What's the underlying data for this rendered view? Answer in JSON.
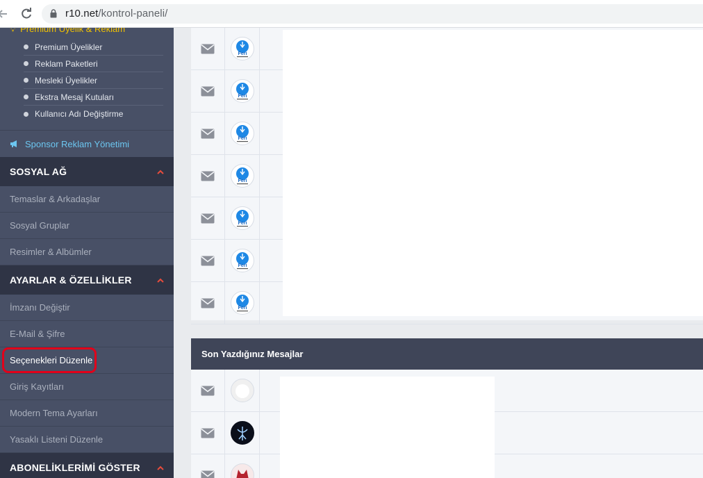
{
  "browser": {
    "url_host": "r10.net",
    "url_path": "/kontrol-paneli/"
  },
  "sidebar": {
    "premium_title": "Premium Üyelik & Reklam",
    "premium_items": [
      {
        "label": "Premium Üyelikler"
      },
      {
        "label": "Reklam Paketleri"
      },
      {
        "label": "Mesleki Üyelikler"
      },
      {
        "label": "Ekstra Mesaj Kutuları"
      },
      {
        "label": "Kullanıcı Adı Değiştirme"
      }
    ],
    "sponsor_label": "Sponsor Reklam Yönetimi",
    "sections": [
      {
        "title": "SOSYAL AĞ",
        "items": [
          {
            "label": "Temaslar & Arkadaşlar"
          },
          {
            "label": "Sosyal Gruplar"
          },
          {
            "label": "Resimler & Albümler"
          }
        ]
      },
      {
        "title": "AYARLAR & ÖZELLİKLER",
        "items": [
          {
            "label": "İmzanı Değiştir"
          },
          {
            "label": "E-Mail & Şifre"
          },
          {
            "label": "Seçenekleri Düzenle"
          },
          {
            "label": "Giriş Kayıtları"
          },
          {
            "label": "Modern Tema Ayarları"
          },
          {
            "label": "Yasaklı Listeni Düzenle"
          }
        ]
      },
      {
        "title": "ABONELİKLERİMİ GÖSTER",
        "items": []
      }
    ]
  },
  "main": {
    "avatar_text": "Feri",
    "messages_title": "Son Yazdığınız Mesajlar"
  },
  "colors": {
    "sidebar_bg": "#485066",
    "section_bg": "#2f3445",
    "accent_red": "#e74c3c",
    "link_blue": "#6cc6f0",
    "highlight": "#e2001a"
  }
}
